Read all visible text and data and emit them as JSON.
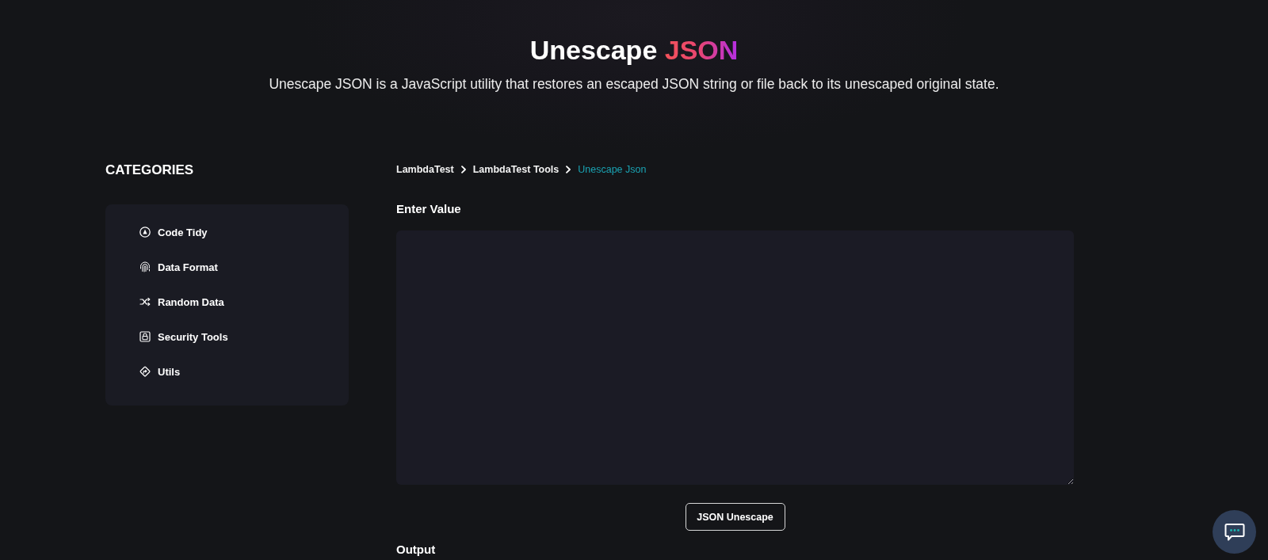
{
  "header": {
    "title": "Unescape",
    "title_highlight": "JSON",
    "description": "Unescape JSON is a JavaScript utility that restores an escaped JSON string or file back to its unescaped original state."
  },
  "sidebar": {
    "heading": "CATEGORIES",
    "items": [
      {
        "label": "Code Tidy"
      },
      {
        "label": "Data Format"
      },
      {
        "label": "Random Data"
      },
      {
        "label": "Security Tools"
      },
      {
        "label": "Utils"
      }
    ]
  },
  "breadcrumb": [
    {
      "label": "LambdaTest",
      "current": false
    },
    {
      "label": "LambdaTest Tools",
      "current": false
    },
    {
      "label": "Unescape Json",
      "current": true
    }
  ],
  "input": {
    "label": "Enter Value"
  },
  "action_button": "JSON Unescape",
  "output": {
    "label": "Output"
  }
}
